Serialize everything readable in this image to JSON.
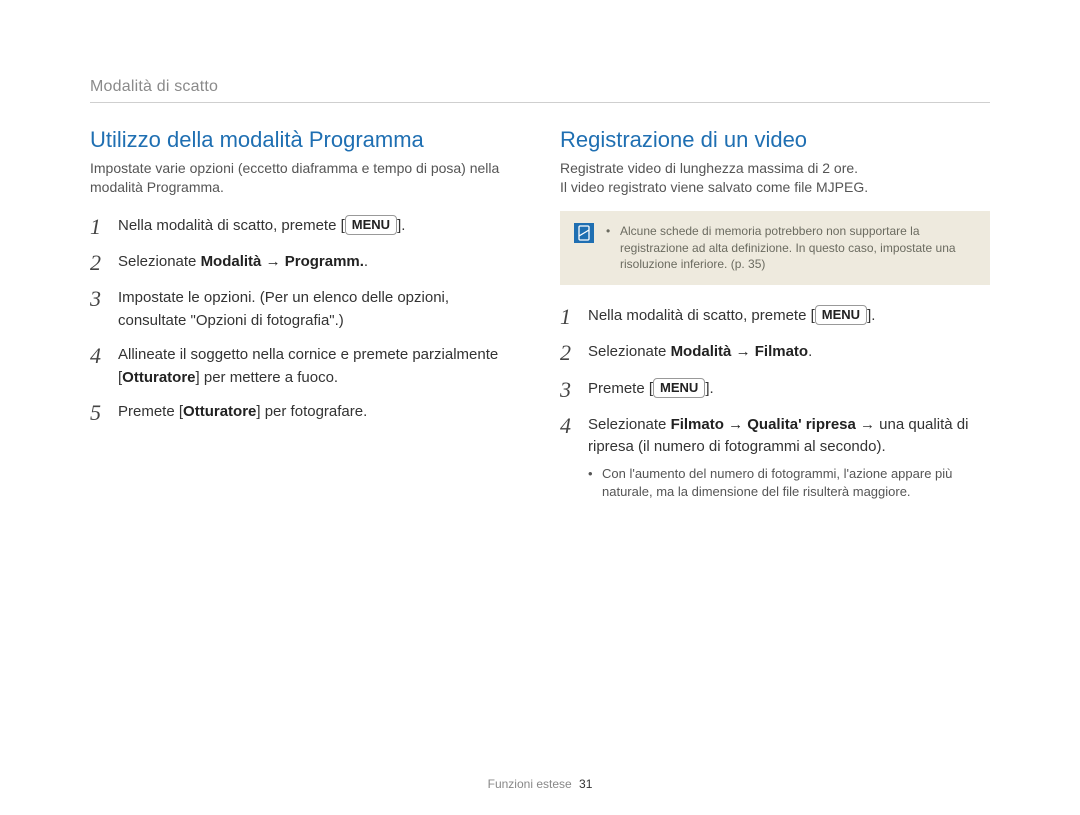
{
  "runningHead": "Modalità di scatto",
  "left": {
    "title": "Utilizzo della modalità Programma",
    "intro": "Impostate varie opzioni (eccetto diaframma e tempo di posa) nella modalità Programma.",
    "steps": {
      "s1_pre": "Nella modalità di scatto, premete [",
      "s1_btn": "MENU",
      "s1_post": "].",
      "s2_pre": "Selezionate ",
      "s2_bold": "Modalità → Programm.",
      "s2_post": ".",
      "s3": "Impostate le opzioni. (Per un elenco delle opzioni, consultate \"Opzioni di fotografia\".)",
      "s4_pre": "Allineate il soggetto nella cornice e premete parzialmente [",
      "s4_bold": "Otturatore",
      "s4_post": "] per mettere a fuoco.",
      "s5_pre": "Premete [",
      "s5_bold": "Otturatore",
      "s5_post": "] per fotografare."
    }
  },
  "right": {
    "title": "Registrazione di un video",
    "intro1": "Registrate video di lunghezza massima di 2 ore.",
    "intro2": "Il video registrato viene salvato come file MJPEG.",
    "note": "Alcune schede di memoria potrebbero non supportare la registrazione ad alta definizione. In questo caso, impostate una risoluzione inferiore. (p. 35)",
    "steps": {
      "s1_pre": "Nella modalità di scatto, premete [",
      "s1_btn": "MENU",
      "s1_post": "].",
      "s2_pre": "Selezionate ",
      "s2_bold": "Modalità → Filmato",
      "s2_post": ".",
      "s3_pre": "Premete [",
      "s3_btn": "MENU",
      "s3_post": "].",
      "s4_pre": "Selezionate ",
      "s4_bold": "Filmato → Qualita' ripresa",
      "s4_post": " → una qualità di ripresa (il numero di fotogrammi al secondo).",
      "s4_bullet": "Con l'aumento del numero di fotogrammi, l'azione appare più naturale, ma la dimensione del file risulterà maggiore."
    }
  },
  "footer": {
    "label": "Funzioni estese",
    "page": "31"
  },
  "nums": {
    "n1": "1",
    "n2": "2",
    "n3": "3",
    "n4": "4",
    "n5": "5"
  }
}
